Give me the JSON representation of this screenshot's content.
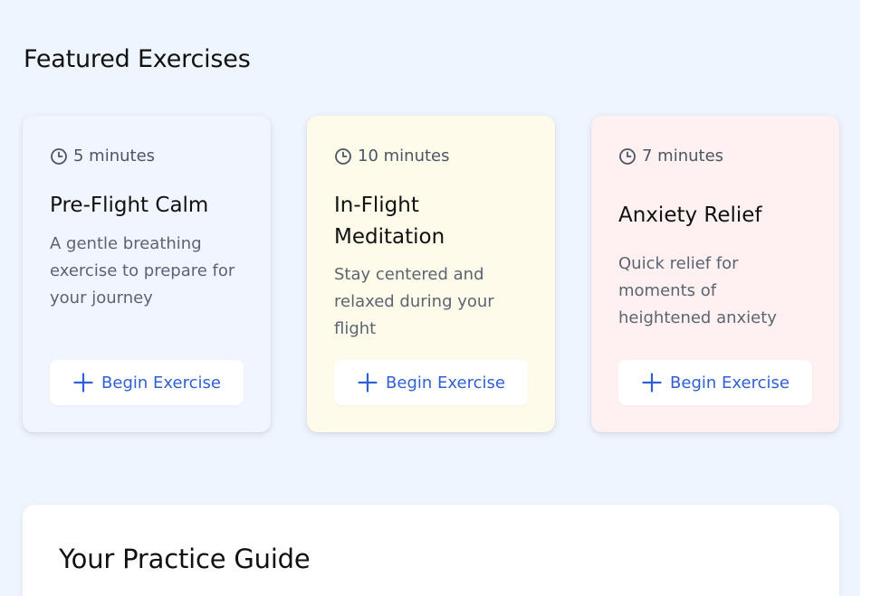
{
  "section": {
    "title": "Featured Exercises"
  },
  "cards": [
    {
      "duration": "5 minutes",
      "title": "Pre-Flight Calm",
      "description": "A gentle breathing exercise to prepare for your journey",
      "button_label": "Begin Exercise"
    },
    {
      "duration": "10 minutes",
      "title": "In-Flight Meditation",
      "description": "Stay centered and relaxed during your flight",
      "button_label": "Begin Exercise"
    },
    {
      "duration": "7 minutes",
      "title": "Anxiety Relief",
      "description": "Quick relief for moments of heightened anxiety",
      "button_label": "Begin Exercise"
    }
  ],
  "guide": {
    "title": "Your Practice Guide"
  },
  "icons": {
    "duration": "clock-icon",
    "button": "plus-icon"
  },
  "colors": {
    "page_background": "#eff5ff",
    "card_blue": "#f0f5ff",
    "card_yellow": "#fefbea",
    "card_pink": "#fff1f1",
    "accent": "#2f5fd6"
  }
}
